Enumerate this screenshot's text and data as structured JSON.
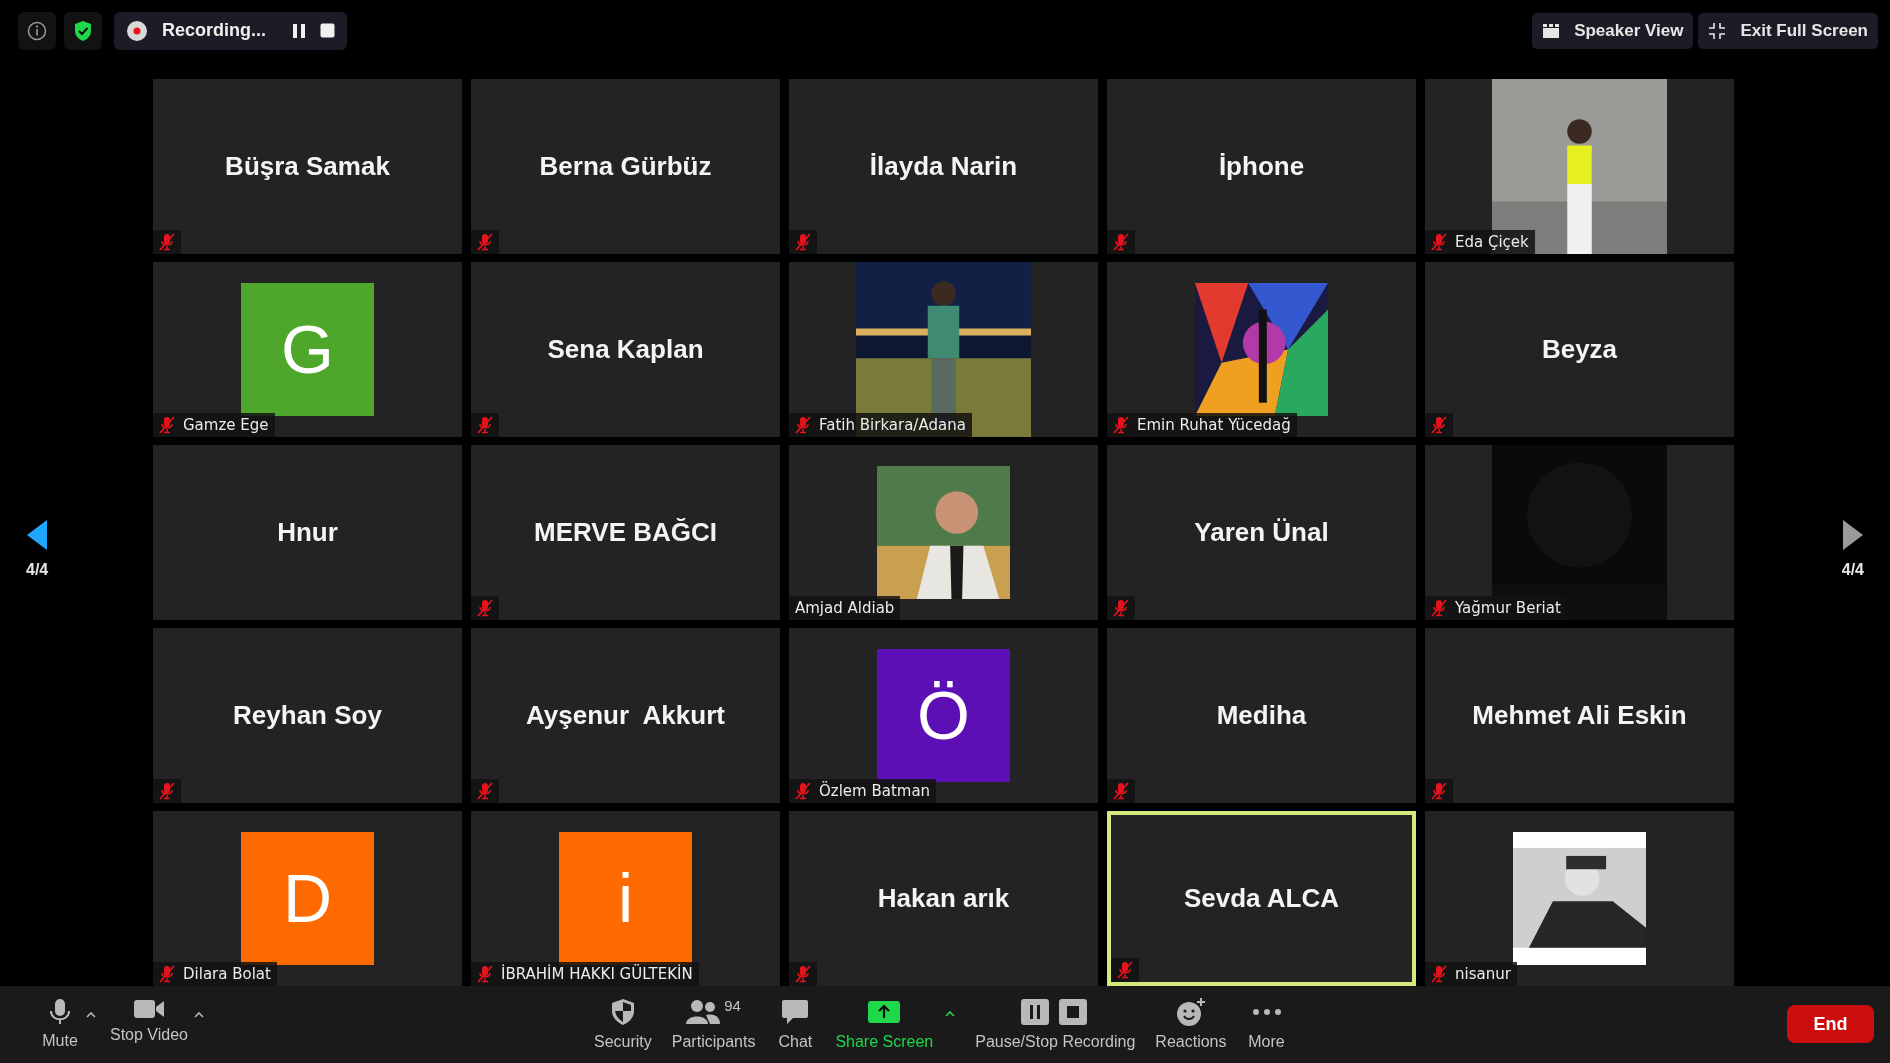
{
  "top_bar": {
    "recording": {
      "label": "Recording..."
    },
    "view_buttons": [
      {
        "kind": "speaker",
        "label": "Speaker View"
      },
      {
        "kind": "exit",
        "label": "Exit Full Screen"
      }
    ]
  },
  "pager": {
    "prev": {
      "label": "4/4",
      "highlighted": true
    },
    "next": {
      "label": "4/4",
      "highlighted": false
    }
  },
  "tiles": [
    {
      "kind": "name",
      "name": "Büşra Samak",
      "muted": true,
      "active": false
    },
    {
      "kind": "name",
      "name": "Berna Gürbüz",
      "muted": true,
      "active": false
    },
    {
      "kind": "name",
      "name": "İlayda Narin",
      "muted": true,
      "active": false
    },
    {
      "kind": "name",
      "name": "İphone",
      "muted": true,
      "active": false
    },
    {
      "kind": "picture",
      "name": "Eda Çiçek",
      "muted": true,
      "active": false
    },
    {
      "kind": "avatar",
      "name": "Gamze Ege",
      "letter": "G",
      "color": "#4ea72a",
      "muted": true,
      "active": false
    },
    {
      "kind": "name",
      "name": "Sena Kaplan",
      "muted": true,
      "active": false
    },
    {
      "kind": "picture",
      "name": "Fatih Birkara/Adana",
      "muted": true,
      "active": false
    },
    {
      "kind": "picture",
      "name": "Emin Ruhat Yücedağ",
      "muted": true,
      "active": false
    },
    {
      "kind": "name",
      "name": "Beyza",
      "muted": true,
      "active": false
    },
    {
      "kind": "name",
      "name": "Hnur",
      "muted": false,
      "active": false
    },
    {
      "kind": "name",
      "name": "MERVE BAĞCI",
      "muted": true,
      "active": false
    },
    {
      "kind": "picture",
      "name": "Amjad Aldiab",
      "muted": false,
      "active": false
    },
    {
      "kind": "name",
      "name": "Yaren Ünal",
      "muted": true,
      "active": false
    },
    {
      "kind": "picture",
      "name": "Yağmur Beriat",
      "muted": true,
      "active": false
    },
    {
      "kind": "name",
      "name": "Reyhan Soy",
      "muted": true,
      "active": false
    },
    {
      "kind": "name",
      "name": "Ayşenur  Akkurt",
      "muted": true,
      "active": false
    },
    {
      "kind": "avatar",
      "name": "Özlem Batman",
      "letter": "Ö",
      "color": "#5c0fb5",
      "muted": true,
      "active": false
    },
    {
      "kind": "name",
      "name": "Mediha",
      "muted": true,
      "active": false
    },
    {
      "kind": "name",
      "name": "Mehmet Ali Eskin",
      "muted": true,
      "active": false
    },
    {
      "kind": "avatar",
      "name": "Dilara Bolat",
      "letter": "D",
      "color": "#ff6a00",
      "muted": true,
      "active": false
    },
    {
      "kind": "avatar",
      "name": "İBRAHİM HAKKI GÜLTEKİN",
      "letter": "i",
      "color": "#ff6a00",
      "muted": true,
      "active": false
    },
    {
      "kind": "name",
      "name": "Hakan arık",
      "muted": true,
      "active": false
    },
    {
      "kind": "name",
      "name": "Sevda ALCA",
      "muted": true,
      "active": true
    },
    {
      "kind": "picture",
      "name": "nisanur",
      "muted": true,
      "active": false
    }
  ],
  "toolbar": {
    "left_controls": [
      {
        "kind": "mic",
        "label": "Mute",
        "caret": true
      },
      {
        "kind": "video",
        "label": "Stop Video",
        "caret": true
      }
    ],
    "center_controls": [
      {
        "kind": "security",
        "label": "Security",
        "caret": false
      },
      {
        "kind": "participants",
        "label": "Participants",
        "count": "94",
        "caret": false
      },
      {
        "kind": "chat",
        "label": "Chat",
        "caret": false
      },
      {
        "kind": "share",
        "label": "Share Screen",
        "caret": true
      },
      {
        "kind": "recording",
        "label": "Pause/Stop Recording",
        "caret": false
      },
      {
        "kind": "reactions",
        "label": "Reactions",
        "caret": false
      },
      {
        "kind": "more",
        "label": "More",
        "caret": false
      }
    ],
    "end_button": "End"
  }
}
